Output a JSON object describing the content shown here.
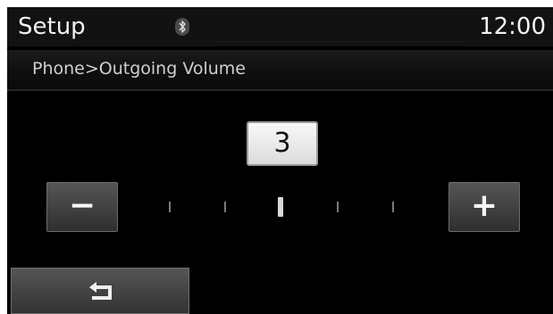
{
  "header": {
    "title": "Setup",
    "clock": "12:00",
    "status_icon": "bluetooth-icon"
  },
  "breadcrumb": {
    "text": "Phone>Outgoing Volume"
  },
  "volume": {
    "value": "3",
    "min_level": 0,
    "max_level": 6,
    "current_level": 3,
    "minus_label": "−",
    "plus_label": "+"
  },
  "footer": {
    "back_icon": "back-arrow-icon"
  },
  "colors": {
    "screen_background": "#000000",
    "text": "#f2f2f2",
    "value_box": "#eeeeee",
    "button": "#444444"
  }
}
